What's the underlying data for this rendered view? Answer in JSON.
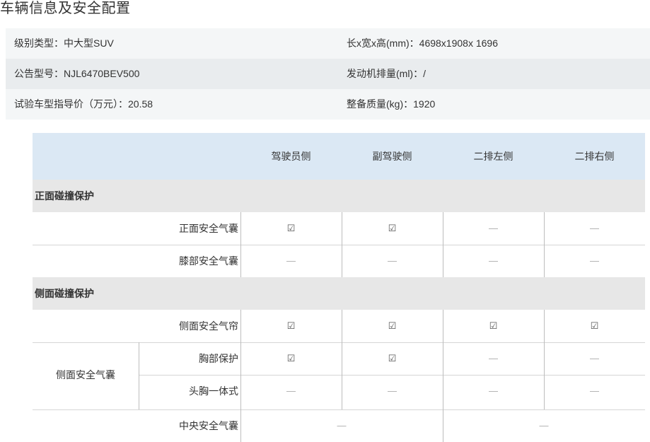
{
  "title": "车辆信息及安全配置",
  "info": {
    "rows": [
      {
        "left_label": "级别类型：",
        "left_value": "中大型SUV",
        "right_label": "长x宽x高(mm)：",
        "right_value": "4698x1908x 1696"
      },
      {
        "left_label": "公告型号：",
        "left_value": "NJL6470BEV500",
        "right_label": "发动机排量(ml)：",
        "right_value": "/"
      },
      {
        "left_label": "试验车型指导价（万元）：",
        "left_value": "20.58",
        "right_label": "整备质量(kg)：",
        "right_value": "1920"
      }
    ]
  },
  "table": {
    "headers": [
      "驾驶员侧",
      "副驾驶侧",
      "二排左侧",
      "二排右侧"
    ],
    "sections": {
      "front": "正面碰撞保护",
      "side": "侧面碰撞保护"
    },
    "rows": {
      "front_airbag": {
        "label": "正面安全气囊",
        "values": [
          "☑",
          "☑",
          "—",
          "—"
        ]
      },
      "knee_airbag": {
        "label": "膝部安全气囊",
        "values": [
          "—",
          "—",
          "—",
          "—"
        ]
      },
      "side_curtain": {
        "label": "侧面安全气帘",
        "values": [
          "☑",
          "☑",
          "☑",
          "☑"
        ]
      },
      "side_airbag_group": "侧面安全气囊",
      "chest": {
        "label": "胸部保护",
        "values": [
          "☑",
          "☑",
          "—",
          "—"
        ]
      },
      "head_chest": {
        "label": "头胸一体式",
        "values": [
          "—",
          "—",
          "—",
          "—"
        ]
      },
      "center_airbag": {
        "label": "中央安全气囊",
        "values": [
          "—",
          "—"
        ]
      }
    }
  }
}
